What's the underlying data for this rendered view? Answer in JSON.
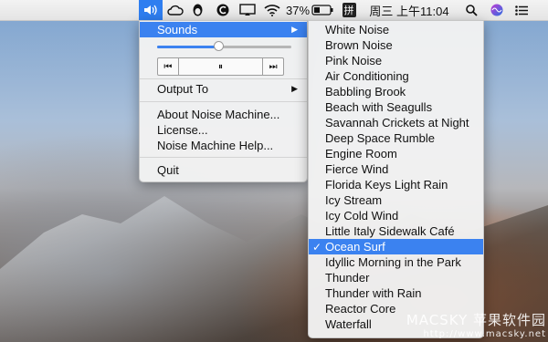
{
  "menubar": {
    "battery": "37%",
    "input_method": "拼",
    "datetime": "周三 上午11:04",
    "icons": [
      "speaker-icon",
      "cloud-icon",
      "qq-penguin-icon",
      "c-app-icon",
      "display-icon",
      "wifi-icon",
      "battery-icon",
      "input-method-icon",
      "search-icon",
      "siri-icon",
      "notification-list-icon"
    ]
  },
  "main_menu": {
    "sounds": "Sounds",
    "volume": 0.46,
    "output_to": "Output To",
    "about": "About Noise Machine...",
    "license": "License...",
    "help": "Noise Machine Help...",
    "quit": "Quit",
    "transport": {
      "prev": "⏮",
      "pause": "⏸",
      "next": "⏭"
    }
  },
  "sounds_menu": {
    "items": [
      "White Noise",
      "Brown Noise",
      "Pink Noise",
      "Air Conditioning",
      "Babbling Brook",
      "Beach with Seagulls",
      "Savannah Crickets at Night",
      "Deep Space Rumble",
      "Engine Room",
      "Fierce Wind",
      "Florida Keys Light Rain",
      "Icy Stream",
      "Icy Cold Wind",
      "Little Italy Sidewalk Café",
      "Ocean Surf",
      "Idyllic Morning in the Park",
      "Thunder",
      "Thunder with Rain",
      "Reactor Core",
      "Waterfall"
    ],
    "selected_index": 14,
    "check": "✓"
  },
  "watermark": {
    "line1": "MACSKY 苹果软件园",
    "line2": "http://www.macsky.net"
  },
  "colors": {
    "accent": "#3b82f0"
  }
}
